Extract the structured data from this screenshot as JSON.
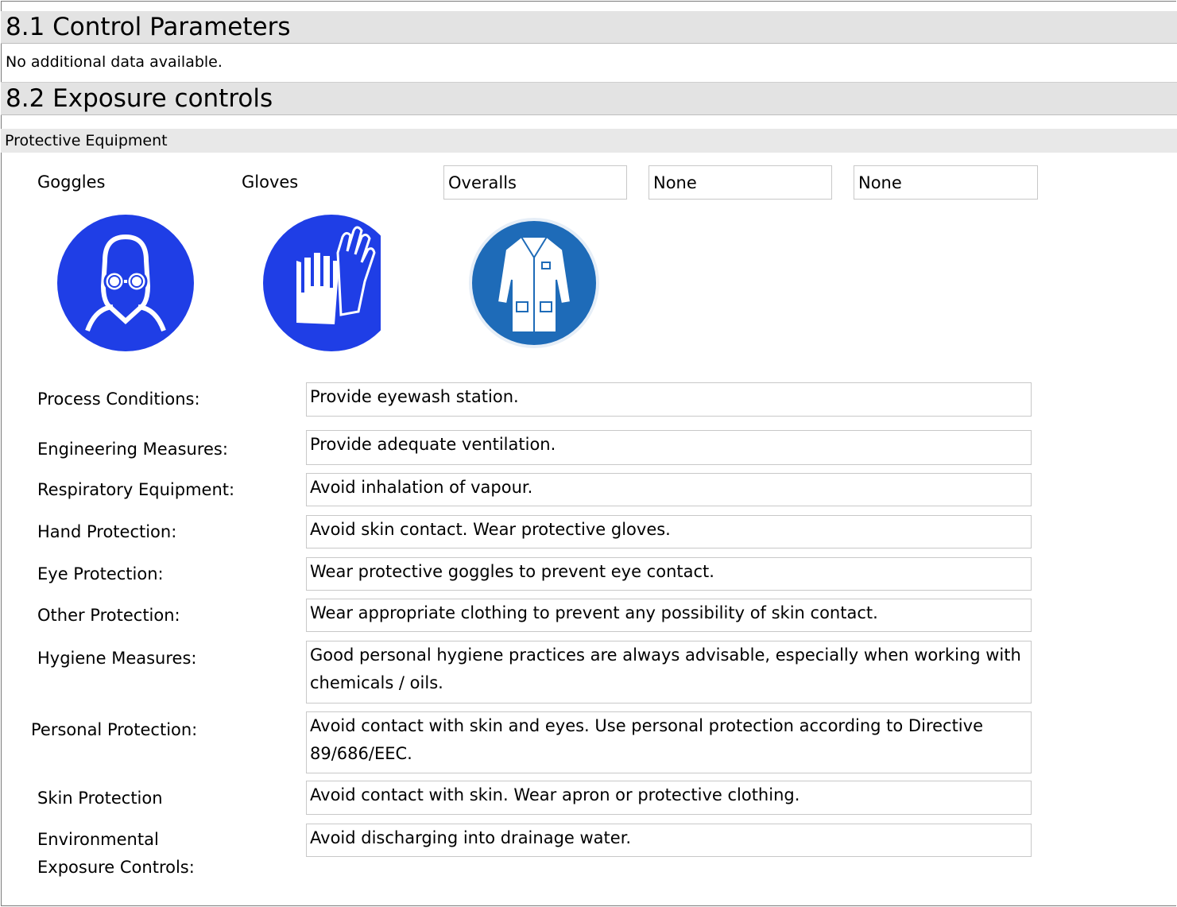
{
  "section_8_1": {
    "title": "8.1 Control Parameters",
    "text": "No additional data available."
  },
  "section_8_2": {
    "title": "8.2 Exposure controls",
    "subtitle": "Protective Equipment"
  },
  "ppe": [
    {
      "label": "Goggles",
      "icon": "goggles-mandatory-icon"
    },
    {
      "label": "Gloves",
      "icon": "gloves-mandatory-icon"
    },
    {
      "label": "Overalls",
      "icon": "overalls-mandatory-icon"
    },
    {
      "label": "None",
      "icon": ""
    },
    {
      "label": "None",
      "icon": ""
    }
  ],
  "colors": {
    "header_bg": "#e3e3e3",
    "sign_blue": "#1f3ee6",
    "overalls_blue": "#1e6bb8"
  },
  "rows": [
    {
      "label": "Process Conditions:",
      "value": "Provide eyewash station."
    },
    {
      "label": "Engineering Measures:",
      "value": "Provide adequate ventilation."
    },
    {
      "label": "Respiratory Equipment:",
      "value": "Avoid inhalation of vapour."
    },
    {
      "label": "Hand Protection:",
      "value": "Avoid skin contact. Wear protective gloves."
    },
    {
      "label": "Eye Protection:",
      "value": "Wear protective goggles to prevent eye contact."
    },
    {
      "label": "Other Protection:",
      "value": "Wear appropriate clothing to prevent any possibility of skin contact."
    },
    {
      "label": "Hygiene Measures:",
      "value": "Good personal hygiene practices are always advisable, especially when working with chemicals / oils."
    },
    {
      "label": "Personal Protection:",
      "value": "Avoid contact with skin and eyes. Use personal protection according to Directive 89/686/EEC."
    },
    {
      "label": "Skin Protection",
      "value": "Avoid contact with skin. Wear apron or protective clothing."
    },
    {
      "label": "Environmental Exposure Controls:",
      "value": "Avoid discharging into drainage water."
    }
  ]
}
